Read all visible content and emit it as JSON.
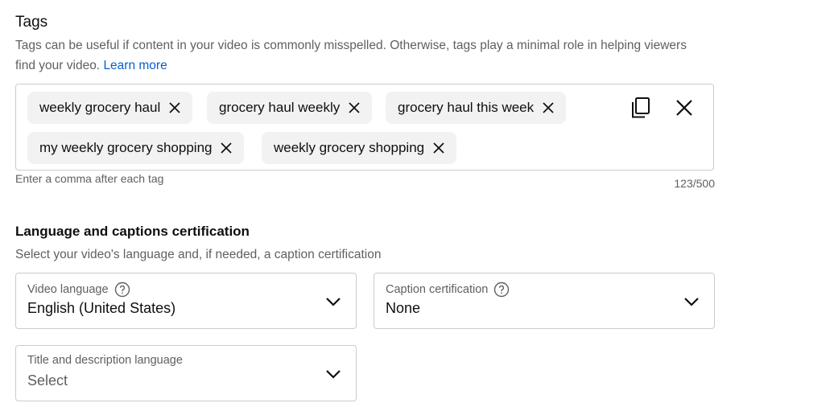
{
  "tags_section": {
    "title": "Tags",
    "description": "Tags can be useful if content in your video is commonly misspelled. Otherwise, tags play a minimal role in helping viewers find your video.",
    "learn_more": "Learn more",
    "tags": [
      "weekly grocery haul",
      "grocery haul weekly",
      "grocery haul this week",
      "my weekly grocery shopping",
      "weekly grocery shopping"
    ],
    "helper_text": "Enter a comma after each tag",
    "counter": "123/500",
    "icons": {
      "copy": "copy-icon",
      "clear": "close-icon",
      "remove_tag": "close-icon"
    }
  },
  "language_section": {
    "title": "Language and captions certification",
    "description": "Select your video's language and, if needed, a caption certification",
    "video_language": {
      "label": "Video language",
      "value": "English (United States)"
    },
    "caption_certification": {
      "label": "Caption certification",
      "value": "None"
    },
    "title_description_language": {
      "label": "Title and description language",
      "value": "Select"
    }
  },
  "colors": {
    "link": "#065fd4",
    "chip_bg": "#f2f2f2",
    "border": "#cccccc",
    "secondary_text": "#606060"
  }
}
